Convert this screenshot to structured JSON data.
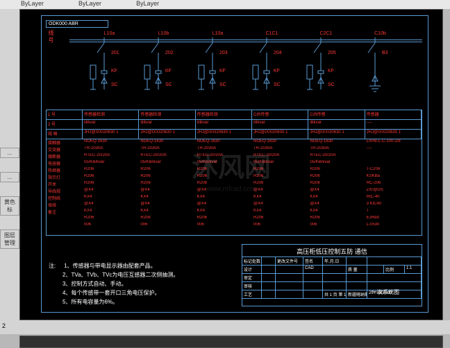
{
  "toolbar": {
    "layer1": "ByLayer",
    "layer2": "ByLayer",
    "layer3": "ByLayer"
  },
  "left_panel": {
    "items": [
      "...",
      "...",
      "黄色标",
      "图层管理"
    ]
  },
  "bottom": {
    "coord": "2"
  },
  "drawing": {
    "title": "ODK000 ABR",
    "left_label": "线 号",
    "circuits": [
      {
        "top": "L10a",
        "sw": "201",
        "cap": "KF",
        "r": "SC"
      },
      {
        "top": "L10b",
        "sw": "202",
        "cap": "KF",
        "r": "SC"
      },
      {
        "top": "L10a",
        "sw": "203",
        "cap": "KF",
        "r": "SC"
      },
      {
        "top": "C1C1",
        "sw": "204",
        "cap": "KF",
        "r": "SC"
      },
      {
        "top": "C2C1",
        "sw": "205",
        "cap": "KF",
        "r": "SC"
      },
      {
        "top": "C10b",
        "sw": "B3",
        "cap": "",
        "r": ""
      }
    ],
    "table": {
      "header_rows": [
        {
          "l": "1 号",
          "c": [
            "传感器检测",
            "传感器检测",
            "传感器检测",
            "C/R传感",
            "C/R传感",
            "传感器"
          ]
        },
        {
          "l": "2 号",
          "c": [
            "iiiikvar",
            "iiiikvar",
            "iiiikvar",
            "iiiikvar",
            "iiiikvar",
            "----"
          ]
        },
        {
          "l": "规 格",
          "c": [
            "JHJ@IXXI20630  1",
            "JHJ@IXXI20630  1",
            "JHJ@IXXI20630  1",
            "JHJ@IXXI20630  1",
            "JHJ@IXXI20630  1",
            "JHJ@IXXI20630  1"
          ]
        }
      ],
      "data_rows": [
        {
          "l": "接触器",
          "c": [
            "NOEQ-1630",
            "NOEQ-1630",
            "NOEQ-1630",
            "NOEQ-1630",
            "NOEQ-1630",
            "LXH8-L-C-100-2/8"
          ]
        },
        {
          "l": "交流器",
          "c": [
            "TR-2030A",
            "TR-2030A",
            "TR-2030A",
            "TR-2030A",
            "TR-2030A",
            "----"
          ]
        },
        {
          "l": "熔断器",
          "c": [
            "RTEC-20/20A",
            "RTEC-20/20A",
            "RTEC-20/20A",
            "RTEC-20/20A",
            "RTEC-20/20A",
            ""
          ]
        },
        {
          "l": "电容器",
          "c": [
            "05/KB/kvar",
            "05/KB/kvar",
            "05/KB/kvar",
            "05/KB/kvar",
            "05/KB/kvar",
            ""
          ]
        },
        {
          "l": "热继器",
          "c": [
            "R206",
            "R206",
            "R206",
            "R206",
            "R206",
            "T-C206"
          ]
        },
        {
          "l": "指示灯",
          "c": [
            "R206",
            "R206",
            "R206",
            "R206",
            "R206",
            "KSKBa"
          ]
        },
        {
          "l": "开关",
          "c": [
            "R206",
            "R206",
            "R206",
            "R206",
            "R206",
            "RC-206"
          ]
        },
        {
          "l": "导线规",
          "c": [
            "@X4",
            "@X4",
            "@X4",
            "@X4",
            "@X4",
            "ZXr@DS"
          ]
        },
        {
          "l": "控制线",
          "c": [
            "KX4",
            "KX4",
            "KX4",
            "KX4",
            "KX4",
            "RIC-40"
          ]
        },
        {
          "l": "母线",
          "c": [
            "@X4",
            "@X4",
            "@X4",
            "@X4",
            "@X4",
            "3 KIC40"
          ]
        },
        {
          "l": "备注",
          "c": [
            "KX4",
            "KX4",
            "KX4",
            "KX4",
            "KX4",
            "T"
          ]
        },
        {
          "l": "",
          "c": [
            "R206",
            "R206",
            "R206",
            "R206",
            "R206",
            "EJRed"
          ]
        },
        {
          "l": "",
          "c": [
            "006",
            "006",
            "006",
            "006",
            "006",
            "L-0530"
          ]
        }
      ]
    },
    "notes": {
      "title": "注:",
      "items": [
        "1、传感器与带电显示器由配套产品。",
        "2、TVa、TVb、TVc为电压互感器二次侧抽测。",
        "3、控制方式自动、手动。",
        "4、每个传感带一套开口三角电压保护。",
        "5、所有电容量为6%。"
      ]
    },
    "title_block": {
      "main": "高压柜低压控制五防 通信",
      "sub": "一次系统图",
      "rows": [
        {
          "c": [
            "标记处数",
            "",
            "更改文件号",
            "签名",
            "年.月.日",
            "",
            ""
          ]
        },
        {
          "c": [
            "设计",
            "",
            "",
            "CAD",
            "",
            "质 量",
            "",
            "比例",
            "1:1"
          ]
        },
        {
          "c": [
            "审定",
            "",
            "",
            "",
            "",
            "",
            ""
          ]
        },
        {
          "c": [
            "审核",
            "",
            "",
            "",
            "",
            "",
            ""
          ]
        },
        {
          "c": [
            "工艺",
            "",
            "",
            "",
            "共 1 页  第 1 页",
            "新疆喀纳斯",
            "25Y.000.000"
          ]
        }
      ]
    }
  },
  "watermark": {
    "main": "沐风网",
    "sub": "www.mfcad.com"
  }
}
